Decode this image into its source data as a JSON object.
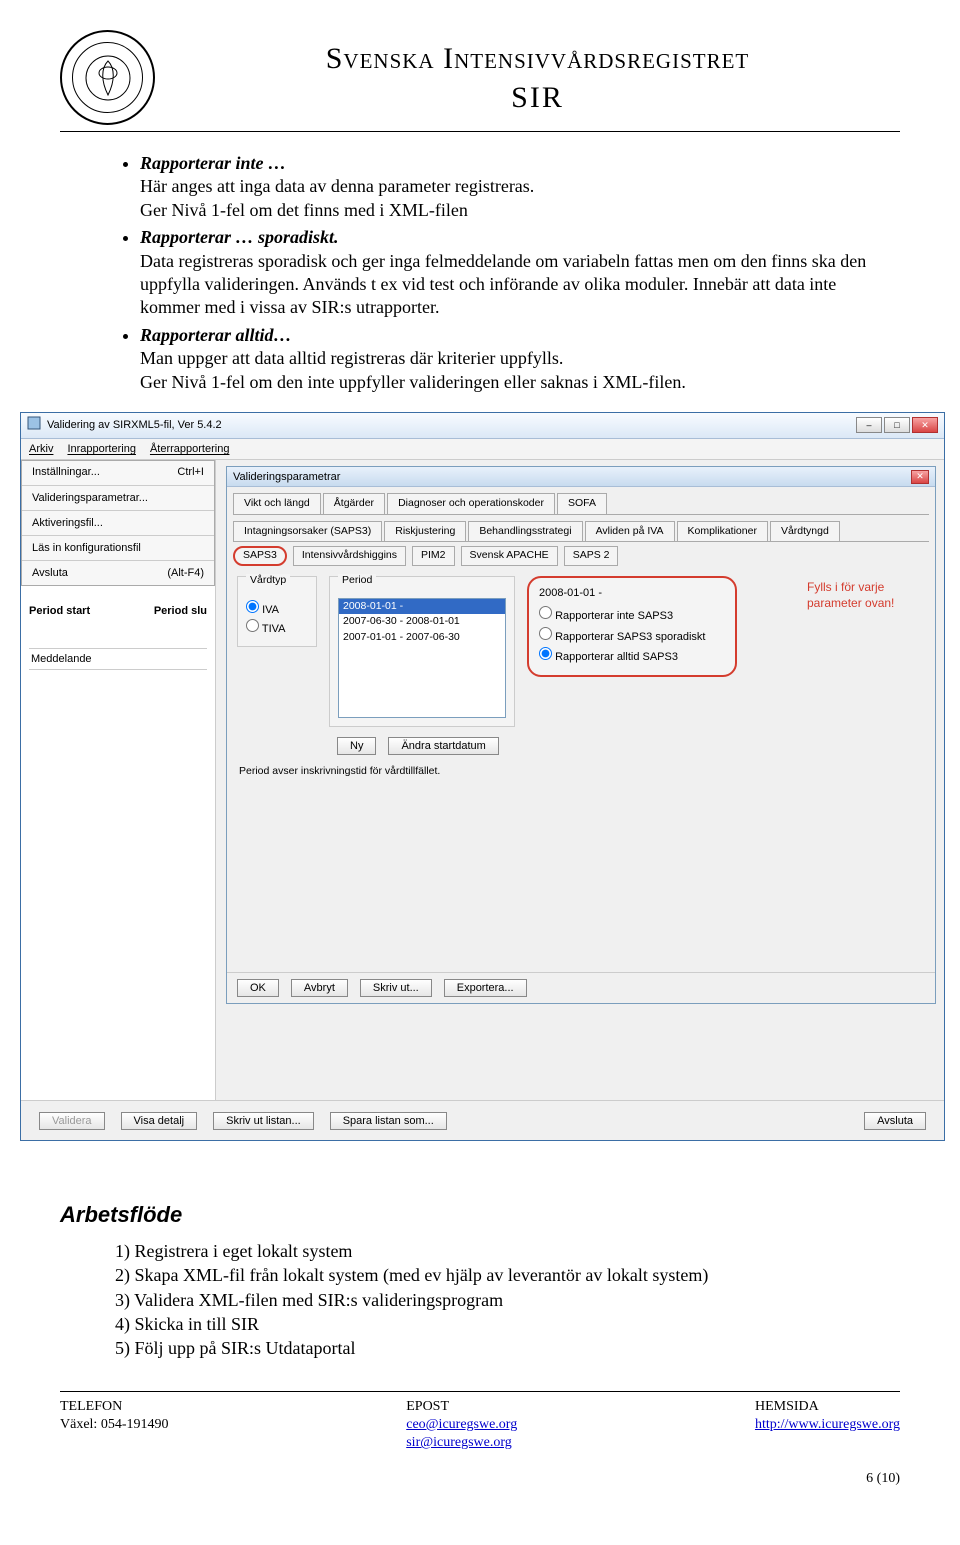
{
  "header": {
    "title_line1": "Svenska Intensivvårdsregistret",
    "title_line2": "SIR"
  },
  "bullets": {
    "b1_term": "Rapporterar inte …",
    "b1_lines": [
      "Här anges att inga data av denna parameter registreras.",
      "Ger Nivå 1-fel om det finns med i XML-filen"
    ],
    "b2_term": "Rapporterar … sporadiskt.",
    "b2_lines": [
      "Data registreras sporadisk och ger inga felmeddelande om variabeln fattas men om den finns ska den uppfylla valideringen. Används t ex vid test och införande av olika moduler. Innebär att data inte kommer med i vissa av SIR:s utrapporter."
    ],
    "b3_term": "Rapporterar alltid…",
    "b3_lines": [
      "Man uppger att data alltid registreras där kriterier uppfylls.",
      "Ger Nivå 1-fel om den inte uppfyller valideringen eller saknas i XML-filen."
    ]
  },
  "app": {
    "title": "Validering av SIRXML5-fil, Ver 5.4.2",
    "menu": {
      "arkiv": "Arkiv",
      "inrapp": "Inrapportering",
      "aterr": "Återrapportering"
    },
    "dropdown": {
      "installningar": "Inställningar...",
      "installningar_key": "Ctrl+I",
      "valideringsparam": "Valideringsparametrar...",
      "aktiveringsfil": "Aktiveringsfil...",
      "lasin": "Läs in konfigurationsfil",
      "avsluta": "Avsluta",
      "avsluta_key": "(Alt-F4)"
    },
    "left": {
      "period_start": "Period start",
      "period_slut": "Period slu",
      "meddelande": "Meddelande"
    },
    "dlg": {
      "title": "Valideringsparametrar",
      "tab_row1": [
        "Vikt och längd",
        "Åtgärder",
        "Diagnoser och operationskoder",
        "SOFA"
      ],
      "tab_row2": [
        "Intagningsorsaker (SAPS3)",
        "Riskjustering",
        "Behandlingsstrategi",
        "Avliden på IVA",
        "Komplikationer",
        "Vårdtyngd"
      ],
      "tab_row3": [
        "SAPS3",
        "Intensivvårdshiggins",
        "PIM2",
        "Svensk APACHE",
        "SAPS 2"
      ],
      "vardtyp_legend": "Vårdtyp",
      "vardtyp_opts": [
        "IVA",
        "TIVA"
      ],
      "period_legend": "Period",
      "period_opts": [
        "2008-01-01 -",
        "2007-06-30 - 2008-01-01",
        "2007-01-01 - 2007-06-30"
      ],
      "circled_date": "2008-01-01 -",
      "circled_opts": [
        "Rapporterar inte SAPS3",
        "Rapporterar SAPS3 sporadiskt",
        "Rapporterar alltid SAPS3"
      ],
      "annotation": "Fylls i för varje parameter ovan!",
      "btn_ny": "Ny",
      "btn_andra": "Ändra startdatum",
      "note": "Period avser inskrivningstid för vårdtillfället.",
      "btn_ok": "OK",
      "btn_avbryt": "Avbryt",
      "btn_skrivut": "Skriv ut...",
      "btn_export": "Exportera..."
    },
    "bottom": {
      "validera": "Validera",
      "visa": "Visa detalj",
      "skrivlist": "Skriv ut listan...",
      "spara": "Spara listan som...",
      "avsluta": "Avsluta"
    }
  },
  "arbetsflode": {
    "heading": "Arbetsflöde",
    "steps": [
      "1) Registrera i eget lokalt system",
      "2) Skapa XML-fil från lokalt system (med ev hjälp av leverantör av lokalt system)",
      "3) Validera XML-filen med SIR:s valideringsprogram",
      "4) Skicka in till SIR",
      "5) Följ upp på SIR:s Utdataportal"
    ]
  },
  "footer": {
    "telefon_label": "TELEFON",
    "telefon_value": "Växel: 054-191490",
    "epost_label": "EPOST",
    "epost_value1": "ceo@icuregswe.org",
    "epost_value2": "sir@icuregswe.org",
    "hemsida_label": "HEMSIDA",
    "hemsida_value": "http://www.icuregswe.org",
    "page": "6 (10)"
  }
}
